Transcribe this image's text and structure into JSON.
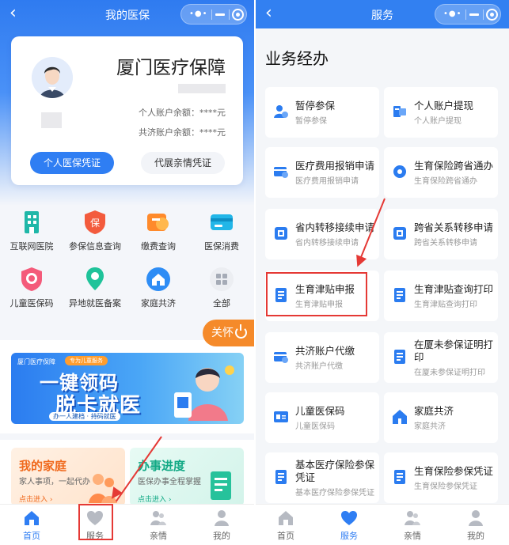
{
  "left": {
    "nav": {
      "title": "我的医保"
    },
    "card": {
      "title": "厦门医疗保障",
      "personal_balance": "个人账户余额：****元",
      "shared_balance": "共济账户余额：****元",
      "primary_button": "个人医保凭证",
      "secondary_button": "代展亲情凭证"
    },
    "grid": [
      {
        "label": "互联网医院",
        "icon": "hospital-building-icon"
      },
      {
        "label": "参保信息查询",
        "icon": "insurance-shield-icon"
      },
      {
        "label": "缴费查询",
        "icon": "payment-icon"
      },
      {
        "label": "医保消费",
        "icon": "card-icon"
      },
      {
        "label": "儿童医保码",
        "icon": "child-code-icon"
      },
      {
        "label": "异地就医备案",
        "icon": "location-pin-icon"
      },
      {
        "label": "家庭共济",
        "icon": "home-icon"
      },
      {
        "label": "全部",
        "icon": "grid-all-icon"
      }
    ],
    "care_pill": "关怀",
    "banner": {
      "logo": "厦门医疗保障",
      "chip": "专为儿童服务",
      "line1": "一键领码",
      "line2": "脱卡就医",
      "sub": "办一人建档 · 持码就医"
    },
    "tiles": [
      {
        "title": "我的家庭",
        "sub": "家人事项，一起代办",
        "link": "点击进入 ›"
      },
      {
        "title": "办事进度",
        "sub": "医保办事全程掌握",
        "link": "点击进入 ›"
      }
    ]
  },
  "right": {
    "nav": {
      "title": "服务"
    },
    "heading": "业务经办",
    "services": [
      {
        "title": "暂停参保",
        "sub": "暂停参保",
        "icon": "person-pause-icon"
      },
      {
        "title": "个人账户提现",
        "sub": "个人账户提现",
        "icon": "withdraw-icon"
      },
      {
        "title": "医疗费用报销申请",
        "sub": "医疗费用报销申请",
        "icon": "reimburse-icon"
      },
      {
        "title": "生育保险跨省通办",
        "sub": "生育保险跨省通办",
        "icon": "gear-icon"
      },
      {
        "title": "省内转移接续申请",
        "sub": "省内转移接续申请",
        "icon": "transfer-icon"
      },
      {
        "title": "跨省关系转移申请",
        "sub": "跨省关系转移申请",
        "icon": "transfer-icon"
      },
      {
        "title": "生育津贴申报",
        "sub": "生育津贴申报",
        "icon": "document-icon"
      },
      {
        "title": "生育津贴查询打印",
        "sub": "生育津贴查询打印",
        "icon": "document-icon"
      },
      {
        "title": "共济账户代缴",
        "sub": "共济账户代缴",
        "icon": "wallet-icon"
      },
      {
        "title": "在厦未参保证明打印",
        "sub": "在厦未参保证明打印",
        "icon": "document-icon"
      },
      {
        "title": "儿童医保码",
        "sub": "儿童医保码",
        "icon": "id-card-icon"
      },
      {
        "title": "家庭共济",
        "sub": "家庭共济",
        "icon": "home-icon"
      },
      {
        "title": "基本医疗保险参保凭证",
        "sub": "基本医疗保险参保凭证",
        "icon": "document-icon"
      },
      {
        "title": "生育保险参保凭证",
        "sub": "生育保险参保凭证",
        "icon": "document-icon"
      }
    ]
  },
  "tabbar": [
    "首页",
    "服务",
    "亲情",
    "我的"
  ],
  "colors": {
    "primary": "#2f7ef3",
    "annotation": "#e53935",
    "care": "#f58a2a"
  }
}
